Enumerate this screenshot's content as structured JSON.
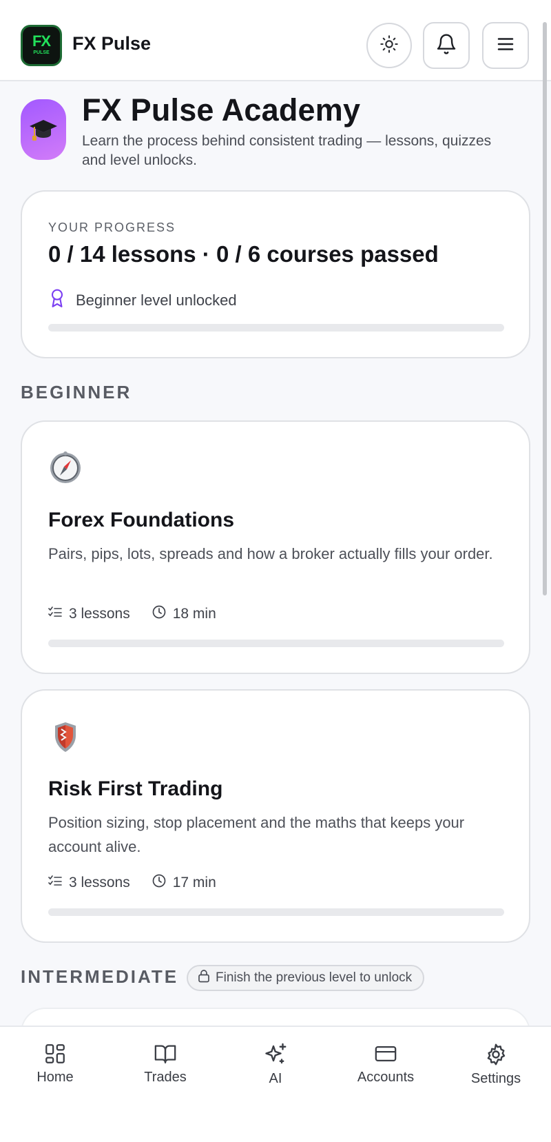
{
  "header": {
    "logo_text": "FX",
    "logo_subtext": "PULSE",
    "brand": "FX Pulse",
    "icons": [
      "sun-icon",
      "bell-icon",
      "menu-icon"
    ]
  },
  "academy": {
    "title": "FX Pulse Academy",
    "subtitle": "Learn the process behind consistent trading — lessons, quizzes and level unlocks.",
    "icon": "graduation-cap-icon"
  },
  "progress": {
    "overline": "YOUR PROGRESS",
    "headline": "0 / 14 lessons · 0 / 6 courses passed",
    "level_text": "Beginner level unlocked",
    "fraction": 0
  },
  "sections": {
    "beginner": "BEGINNER",
    "intermediate": "INTERMEDIATE",
    "lock_note": "Finish the previous level to unlock"
  },
  "courses": [
    {
      "icon": "compass-icon",
      "title": "Forex Foundations",
      "description": "Pairs, pips, lots, spreads and how a broker actually fills your order.",
      "lessons": "3 lessons",
      "duration": "18 min",
      "progress": 0
    },
    {
      "icon": "shield-icon",
      "title": "Risk First Trading",
      "description": "Position sizing, stop placement and the maths that keeps your account alive.",
      "lessons": "3 lessons",
      "duration": "17 min",
      "progress": 0
    }
  ],
  "nav": [
    {
      "label": "Home",
      "icon": "grid-icon"
    },
    {
      "label": "Trades",
      "icon": "book-icon"
    },
    {
      "label": "AI",
      "icon": "sparkle-icon"
    },
    {
      "label": "Accounts",
      "icon": "card-icon"
    },
    {
      "label": "Settings",
      "icon": "gear-icon"
    }
  ],
  "colors": {
    "accent": "#6a3df0",
    "badge_gradient_start": "#a259ff",
    "badge_gradient_end": "#d27cf8",
    "logo_green": "#22e05a"
  }
}
